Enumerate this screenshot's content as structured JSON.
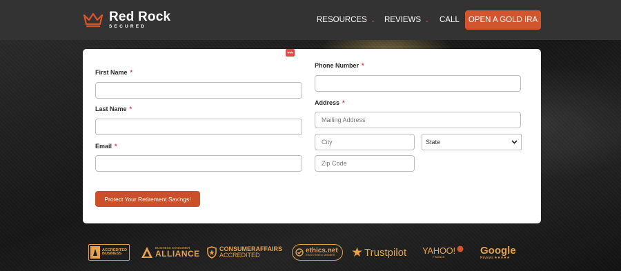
{
  "header": {
    "logo": {
      "name": "Red Rock",
      "tagline": "SECURED"
    },
    "nav": [
      {
        "label": "RESOURCES",
        "dropdown": true
      },
      {
        "label": "REVIEWS",
        "dropdown": true
      },
      {
        "label": "CALL",
        "dropdown": false
      }
    ],
    "cta_label": "OPEN A GOLD IRA"
  },
  "form": {
    "first_name": {
      "label": "First Name",
      "required": "*",
      "value": "",
      "placeholder": ""
    },
    "last_name": {
      "label": "Last Name",
      "required": "*",
      "value": "",
      "placeholder": ""
    },
    "email": {
      "label": "Email",
      "required": "*",
      "value": "",
      "placeholder": ""
    },
    "phone": {
      "label": "Phone Number",
      "required": "*",
      "value": "",
      "placeholder": ""
    },
    "address": {
      "label": "Address",
      "required": "*",
      "mailing_placeholder": "Mailing Address",
      "city_placeholder": "City",
      "state_selected": "State",
      "zip_placeholder": "Zip Code"
    },
    "submit_label": "Protect Your Retirement Savings!",
    "menu_dots": "•••"
  },
  "badges": {
    "bbb": {
      "line1": "ACCREDITED",
      "line2": "BUSINESS"
    },
    "alliance": {
      "small": "BUSINESS CONSUMER",
      "main": "ALLIANCE"
    },
    "consumer_affairs": {
      "line1": "CONSUMERAFFAIRS",
      "line2": "ACCREDITED"
    },
    "ethics": {
      "main": "ethics.net",
      "sub": "REGISTERED MEMBER"
    },
    "trustpilot": {
      "label": "Trustpilot"
    },
    "yahoo": {
      "main": "YAHOO!",
      "sub": "FINANCE"
    },
    "google": {
      "main": "Google",
      "sub": "Reviews ★★★★★"
    }
  },
  "colors": {
    "accent": "#d2552d",
    "header_bg": "#333333",
    "badge_gold": "#e6a24a"
  }
}
